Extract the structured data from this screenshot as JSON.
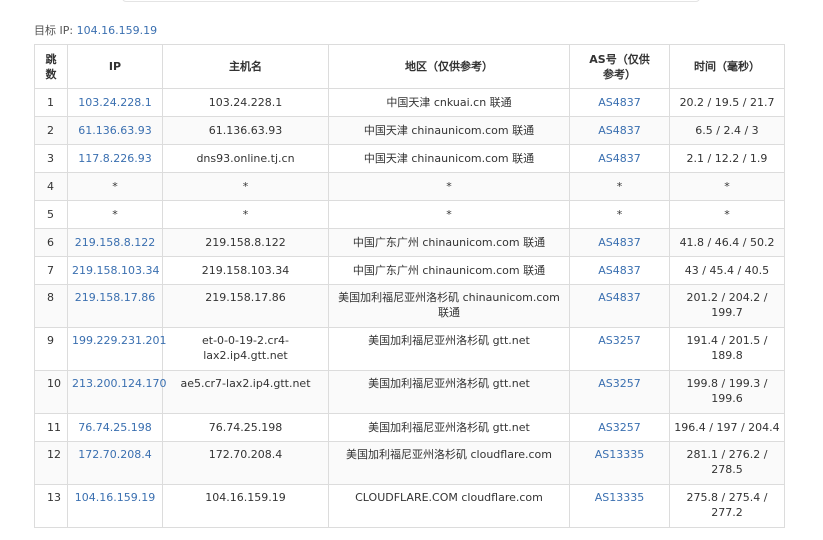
{
  "target": {
    "label": "目标 IP:",
    "ip": "104.16.159.19"
  },
  "table": {
    "headers": {
      "hop": "跳数",
      "ip": "IP",
      "host": "主机名",
      "region": "地区（仅供参考）",
      "as": "AS号（仅供参考）",
      "time": "时间（毫秒）"
    },
    "rows": [
      {
        "hop": "1",
        "ip": "103.24.228.1",
        "host": "103.24.228.1",
        "region": "中国天津 cnkuai.cn 联通",
        "as": "AS4837",
        "time": "20.2 / 19.5 / 21.7"
      },
      {
        "hop": "2",
        "ip": "61.136.63.93",
        "host": "61.136.63.93",
        "region": "中国天津 chinaunicom.com 联通",
        "as": "AS4837",
        "time": "6.5 / 2.4 / 3"
      },
      {
        "hop": "3",
        "ip": "117.8.226.93",
        "host": "dns93.online.tj.cn",
        "region": "中国天津 chinaunicom.com 联通",
        "as": "AS4837",
        "time": "2.1 / 12.2 / 1.9"
      },
      {
        "hop": "4",
        "ip": "*",
        "host": "*",
        "region": "*",
        "as": "*",
        "time": "*"
      },
      {
        "hop": "5",
        "ip": "*",
        "host": "*",
        "region": "*",
        "as": "*",
        "time": "*"
      },
      {
        "hop": "6",
        "ip": "219.158.8.122",
        "host": "219.158.8.122",
        "region": "中国广东广州 chinaunicom.com 联通",
        "as": "AS4837",
        "time": "41.8 / 46.4 / 50.2"
      },
      {
        "hop": "7",
        "ip": "219.158.103.34",
        "host": "219.158.103.34",
        "region": "中国广东广州 chinaunicom.com 联通",
        "as": "AS4837",
        "time": "43 / 45.4 / 40.5"
      },
      {
        "hop": "8",
        "ip": "219.158.17.86",
        "host": "219.158.17.86",
        "region": "美国加利福尼亚州洛杉矶 chinaunicom.com 联通",
        "as": "AS4837",
        "time": "201.2 / 204.2 / 199.7"
      },
      {
        "hop": "9",
        "ip": "199.229.231.201",
        "host": "et-0-0-19-2.cr4-lax2.ip4.gtt.net",
        "region": "美国加利福尼亚州洛杉矶 gtt.net",
        "as": "AS3257",
        "time": "191.4 / 201.5 / 189.8"
      },
      {
        "hop": "10",
        "ip": "213.200.124.170",
        "host": "ae5.cr7-lax2.ip4.gtt.net",
        "region": "美国加利福尼亚州洛杉矶 gtt.net",
        "as": "AS3257",
        "time": "199.8 / 199.3 / 199.6"
      },
      {
        "hop": "11",
        "ip": "76.74.25.198",
        "host": "76.74.25.198",
        "region": "美国加利福尼亚州洛杉矶 gtt.net",
        "as": "AS3257",
        "time": "196.4 / 197 / 204.4"
      },
      {
        "hop": "12",
        "ip": "172.70.208.4",
        "host": "172.70.208.4",
        "region": "美国加利福尼亚州洛杉矶 cloudflare.com",
        "as": "AS13335",
        "time": "281.1 / 276.2 / 278.5"
      },
      {
        "hop": "13",
        "ip": "104.16.159.19",
        "host": "104.16.159.19",
        "region": "CLOUDFLARE.COM cloudflare.com",
        "as": "AS13335",
        "time": "275.8 / 275.4 / 277.2"
      }
    ]
  }
}
